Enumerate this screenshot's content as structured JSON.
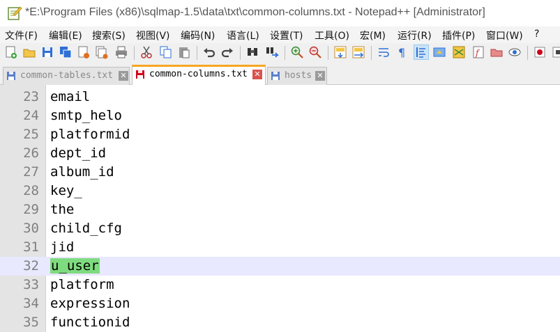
{
  "window": {
    "title": "*E:\\Program Files (x86)\\sqlmap-1.5\\data\\txt\\common-columns.txt - Notepad++ [Administrator]"
  },
  "menu": [
    "文件(F)",
    "编辑(E)",
    "搜索(S)",
    "视图(V)",
    "编码(N)",
    "语言(L)",
    "设置(T)",
    "工具(O)",
    "宏(M)",
    "运行(R)",
    "插件(P)",
    "窗口(W)",
    "?"
  ],
  "tabs": [
    {
      "label": "common-tables.txt",
      "close": "✕"
    },
    {
      "label": "common-columns.txt",
      "close": "✕"
    },
    {
      "label": "hosts",
      "close": "✕"
    }
  ],
  "editor": {
    "lines": [
      {
        "num": "23",
        "text": "email"
      },
      {
        "num": "24",
        "text": "smtp_helo"
      },
      {
        "num": "25",
        "text": "platformid"
      },
      {
        "num": "26",
        "text": "dept_id"
      },
      {
        "num": "27",
        "text": "album_id"
      },
      {
        "num": "28",
        "text": "key_"
      },
      {
        "num": "29",
        "text": "the"
      },
      {
        "num": "30",
        "text": "child_cfg"
      },
      {
        "num": "31",
        "text": "jid"
      },
      {
        "num": "32",
        "text": "u_user"
      },
      {
        "num": "33",
        "text": "platform"
      },
      {
        "num": "34",
        "text": "expression"
      },
      {
        "num": "35",
        "text": "functionid"
      }
    ]
  },
  "colors": {
    "tab_active_accent": "#f6a623",
    "current_line": "#e8e8ff",
    "selection": "#7fdb7f"
  }
}
